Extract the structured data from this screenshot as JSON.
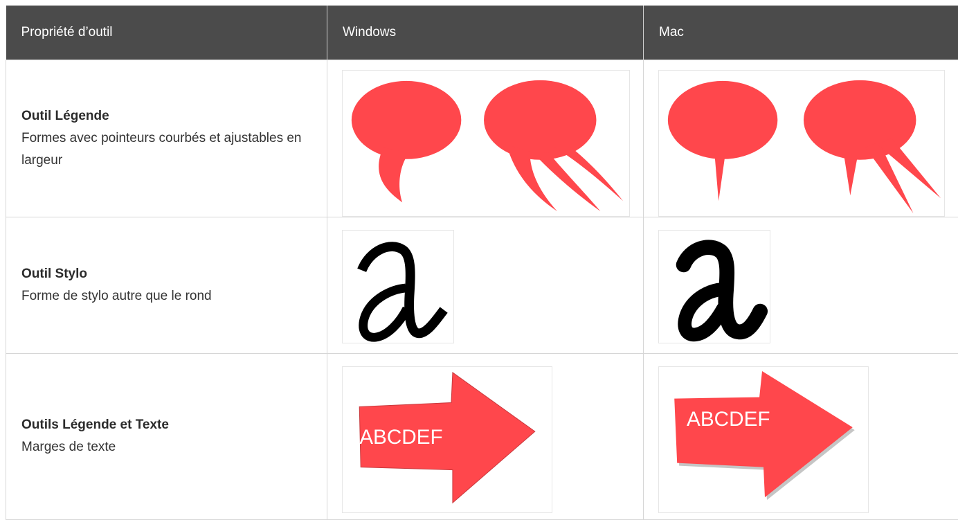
{
  "table": {
    "headers": [
      "Propriété d’outil",
      "Windows",
      "Mac"
    ],
    "rows": [
      {
        "title": "Outil Légende",
        "description": "Formes avec pointeurs courbés et ajustables en largeur",
        "windows_image": "speech-callouts-curved-pointer",
        "mac_image": "speech-callouts-straight-pointer"
      },
      {
        "title": "Outil Stylo",
        "description": "Forme de stylo autre que le rond",
        "windows_image": "pen-letter-a-calligraphic",
        "mac_image": "pen-letter-a-round"
      },
      {
        "title": "Outils Légende et Texte",
        "description": "Marges de texte",
        "windows_image": "arrow-callout-text",
        "mac_image": "arrow-callout-text",
        "windows_arrow_text": "ABCDEF",
        "mac_arrow_text": "ABCDEF"
      }
    ]
  },
  "colors": {
    "header_bg": "#4b4b4b",
    "header_text": "#ffffff",
    "shape_red": "#ff474c",
    "border": "#d6d6d6"
  }
}
